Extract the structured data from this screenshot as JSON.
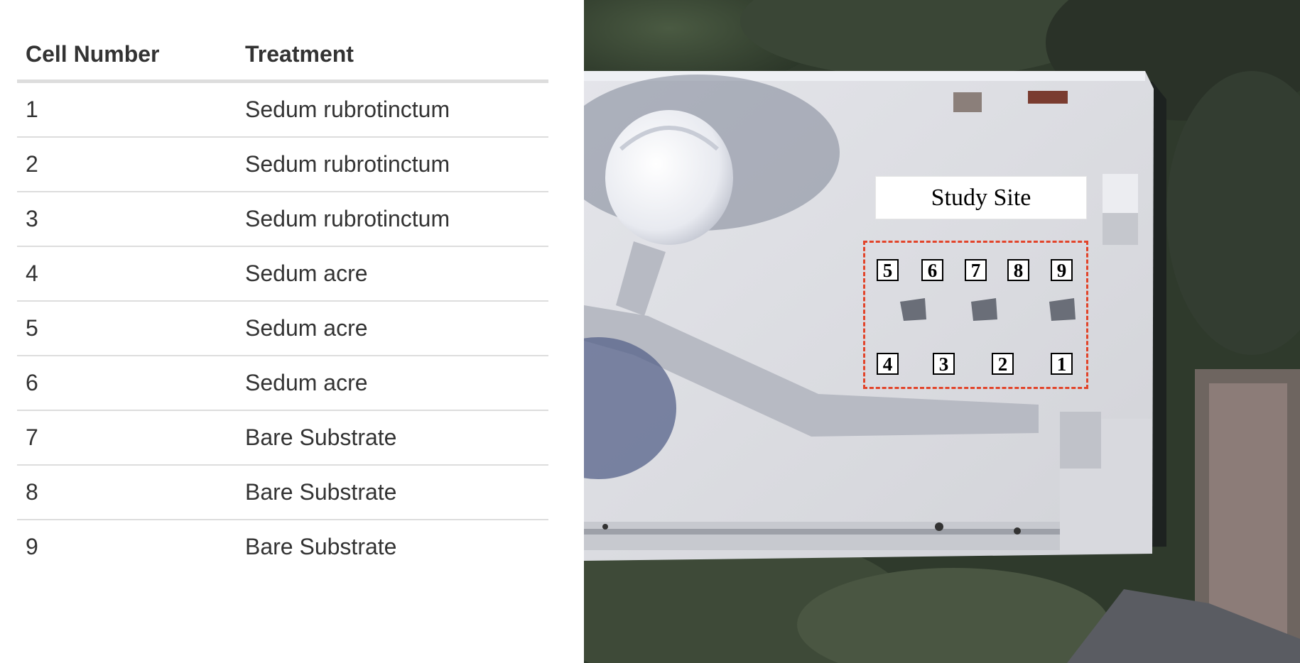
{
  "table": {
    "headers": {
      "cell_number": "Cell Number",
      "treatment": "Treatment"
    },
    "rows": [
      {
        "cell": "1",
        "treatment": "Sedum rubrotinctum"
      },
      {
        "cell": "2",
        "treatment": "Sedum rubrotinctum"
      },
      {
        "cell": "3",
        "treatment": "Sedum rubrotinctum"
      },
      {
        "cell": "4",
        "treatment": "Sedum acre"
      },
      {
        "cell": "5",
        "treatment": "Sedum acre"
      },
      {
        "cell": "6",
        "treatment": "Sedum acre"
      },
      {
        "cell": "7",
        "treatment": "Bare Substrate"
      },
      {
        "cell": "8",
        "treatment": "Bare Substrate"
      },
      {
        "cell": "9",
        "treatment": "Bare Substrate"
      }
    ]
  },
  "map": {
    "label": "Study Site",
    "cells_top_row": [
      "5",
      "6",
      "7",
      "8",
      "9"
    ],
    "cells_bottom_row": [
      "4",
      "3",
      "2",
      "1"
    ],
    "colors": {
      "study_boundary": "#e2442a",
      "roof": "#dadbe0",
      "vegetation": "#2f3a2c"
    }
  }
}
